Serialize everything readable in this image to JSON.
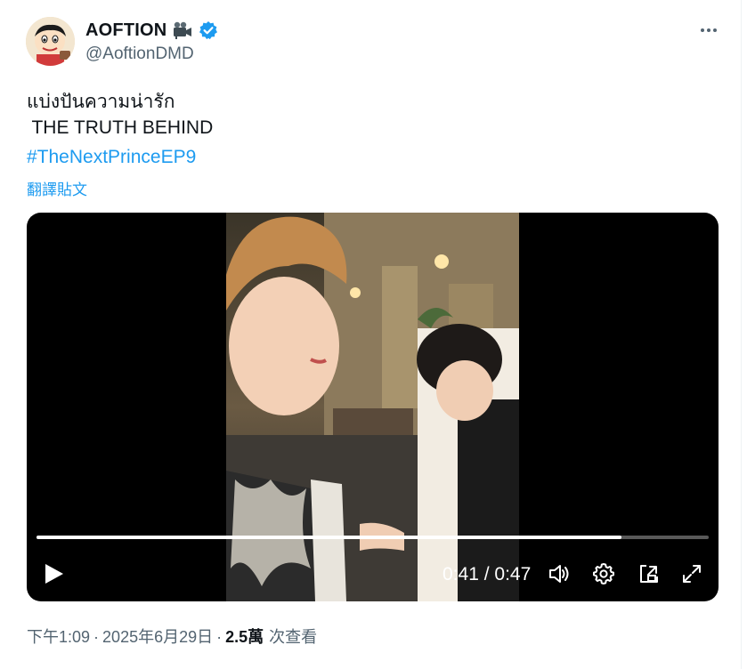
{
  "tweet": {
    "display_name": "AOFTION",
    "handle": "@AoftionDMD",
    "text_line_1": "แบ่งปันความน่ารัก",
    "text_line_2": " THE TRUTH BEHIND",
    "hashtag": "#TheNextPrinceEP9",
    "translate_label": "翻譯貼文",
    "time": "下午1:09",
    "separator": "·",
    "date": "2025年6月29日",
    "views_count": "2.5萬",
    "views_label": "次查看"
  },
  "video": {
    "current_time": "0:41",
    "time_separator": " / ",
    "duration": "0:47",
    "progress": 0.87
  },
  "icons": {
    "avatar": "cartoon-boy-avatar",
    "name_emoji": "movie-camera-icon",
    "verified": "verified-badge-icon",
    "more": "more-dots-icon",
    "play": "play-icon",
    "volume": "volume-icon",
    "settings": "gear-icon",
    "pip": "picture-in-picture-icon",
    "fullscreen": "fullscreen-icon"
  },
  "colors": {
    "accent": "#1d9bf0",
    "text": "#0f1419",
    "muted": "#536471"
  }
}
